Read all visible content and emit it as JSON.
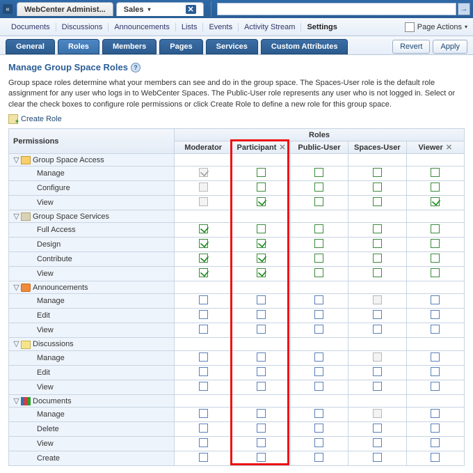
{
  "topbar": {
    "back_tab": "WebCenter Administ...",
    "active_tab": "Sales"
  },
  "menubar": {
    "items": [
      "Documents",
      "Discussions",
      "Announcements",
      "Lists",
      "Events",
      "Activity Stream",
      "Settings"
    ],
    "active_index": 6,
    "page_actions": "Page Actions"
  },
  "subtabs": {
    "items": [
      "General",
      "Roles",
      "Members",
      "Pages",
      "Services",
      "Custom Attributes"
    ],
    "active_index": 1,
    "revert": "Revert",
    "apply": "Apply"
  },
  "content": {
    "heading": "Manage Group Space Roles",
    "desc": "Group space roles determine what your members can see and do in the group space. The Spaces-User role is the default role assignment for any user who logs in to WebCenter Spaces. The Public-User role represents any user who is not logged in. Select or clear the check boxes to configure role permissions or click Create Role to define a new role for this group space.",
    "create_role": "Create Role"
  },
  "table": {
    "permissions_header": "Permissions",
    "roles_header": "Roles",
    "roles": [
      {
        "name": "Moderator",
        "deletable": false
      },
      {
        "name": "Participant",
        "deletable": true
      },
      {
        "name": "Public-User",
        "deletable": false
      },
      {
        "name": "Spaces-User",
        "deletable": false
      },
      {
        "name": "Viewer",
        "deletable": true
      }
    ],
    "groups": [
      {
        "name": "Group Space Access",
        "icon": "grp-gs",
        "rows": [
          {
            "name": "Manage",
            "cells": [
              {
                "c": true,
                "d": true
              },
              {
                "c": false
              },
              {
                "c": false
              },
              {
                "c": false
              },
              {
                "c": false
              }
            ]
          },
          {
            "name": "Configure",
            "cells": [
              {
                "c": false,
                "d": true
              },
              {
                "c": false
              },
              {
                "c": false
              },
              {
                "c": false
              },
              {
                "c": false
              }
            ]
          },
          {
            "name": "View",
            "cells": [
              {
                "c": false,
                "d": true
              },
              {
                "c": true
              },
              {
                "c": false
              },
              {
                "c": false
              },
              {
                "c": true
              }
            ]
          }
        ]
      },
      {
        "name": "Group Space Services",
        "icon": "grp-svc",
        "rows": [
          {
            "name": "Full Access",
            "cells": [
              {
                "c": true
              },
              {
                "c": false
              },
              {
                "c": false
              },
              {
                "c": false
              },
              {
                "c": false
              }
            ]
          },
          {
            "name": "Design",
            "cells": [
              {
                "c": true
              },
              {
                "c": true
              },
              {
                "c": false
              },
              {
                "c": false
              },
              {
                "c": false
              }
            ]
          },
          {
            "name": "Contribute",
            "cells": [
              {
                "c": true
              },
              {
                "c": true
              },
              {
                "c": false
              },
              {
                "c": false
              },
              {
                "c": false
              }
            ]
          },
          {
            "name": "View",
            "cells": [
              {
                "c": true
              },
              {
                "c": true
              },
              {
                "c": false
              },
              {
                "c": false
              },
              {
                "c": false
              }
            ]
          }
        ]
      },
      {
        "name": "Announcements",
        "icon": "grp-ann",
        "rows": [
          {
            "name": "Manage",
            "cells": [
              {
                "c": false,
                "b": true
              },
              {
                "c": false,
                "b": true
              },
              {
                "c": false,
                "b": true
              },
              {
                "c": false,
                "d": true
              },
              {
                "c": false,
                "b": true
              }
            ]
          },
          {
            "name": "Edit",
            "cells": [
              {
                "c": false,
                "b": true
              },
              {
                "c": false,
                "b": true
              },
              {
                "c": false,
                "b": true
              },
              {
                "c": false,
                "b": true
              },
              {
                "c": false,
                "b": true
              }
            ]
          },
          {
            "name": "View",
            "cells": [
              {
                "c": false,
                "b": true
              },
              {
                "c": false,
                "b": true
              },
              {
                "c": false,
                "b": true
              },
              {
                "c": false,
                "b": true
              },
              {
                "c": false,
                "b": true
              }
            ]
          }
        ]
      },
      {
        "name": "Discussions",
        "icon": "grp-disc",
        "rows": [
          {
            "name": "Manage",
            "cells": [
              {
                "c": false,
                "b": true
              },
              {
                "c": false,
                "b": true
              },
              {
                "c": false,
                "b": true
              },
              {
                "c": false,
                "d": true
              },
              {
                "c": false,
                "b": true
              }
            ]
          },
          {
            "name": "Edit",
            "cells": [
              {
                "c": false,
                "b": true
              },
              {
                "c": false,
                "b": true
              },
              {
                "c": false,
                "b": true
              },
              {
                "c": false,
                "b": true
              },
              {
                "c": false,
                "b": true
              }
            ]
          },
          {
            "name": "View",
            "cells": [
              {
                "c": false,
                "b": true
              },
              {
                "c": false,
                "b": true
              },
              {
                "c": false,
                "b": true
              },
              {
                "c": false,
                "b": true
              },
              {
                "c": false,
                "b": true
              }
            ]
          }
        ]
      },
      {
        "name": "Documents",
        "icon": "grp-doc",
        "rows": [
          {
            "name": "Manage",
            "cells": [
              {
                "c": false,
                "b": true
              },
              {
                "c": false,
                "b": true
              },
              {
                "c": false,
                "b": true
              },
              {
                "c": false,
                "d": true
              },
              {
                "c": false,
                "b": true
              }
            ]
          },
          {
            "name": "Delete",
            "cells": [
              {
                "c": false,
                "b": true
              },
              {
                "c": false,
                "b": true
              },
              {
                "c": false,
                "b": true
              },
              {
                "c": false,
                "b": true
              },
              {
                "c": false,
                "b": true
              }
            ]
          },
          {
            "name": "View",
            "cells": [
              {
                "c": false,
                "b": true
              },
              {
                "c": false,
                "b": true
              },
              {
                "c": false,
                "b": true
              },
              {
                "c": false,
                "b": true
              },
              {
                "c": false,
                "b": true
              }
            ]
          },
          {
            "name": "Create",
            "cells": [
              {
                "c": false,
                "b": true
              },
              {
                "c": false,
                "b": true
              },
              {
                "c": false,
                "b": true
              },
              {
                "c": false,
                "b": true
              },
              {
                "c": false,
                "b": true
              }
            ]
          }
        ]
      }
    ]
  }
}
